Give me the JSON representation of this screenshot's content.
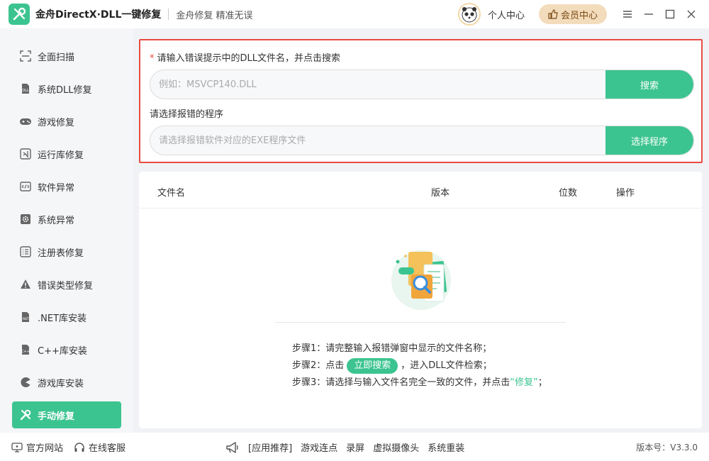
{
  "app": {
    "title": "金舟DirectX·DLL一键修复",
    "slogan": "金舟修复 精准无误",
    "personal_center": "个人中心",
    "vip_center": "会员中心"
  },
  "sidebar": {
    "items": [
      {
        "label": "全面扫描",
        "icon": "scan-icon"
      },
      {
        "label": "系统DLL修复",
        "icon": "dll-icon"
      },
      {
        "label": "游戏修复",
        "icon": "gamepad-icon"
      },
      {
        "label": "运行库修复",
        "icon": "vs-icon"
      },
      {
        "label": "软件异常",
        "icon": "code-icon"
      },
      {
        "label": "系统异常",
        "icon": "gear-icon"
      },
      {
        "label": "注册表修复",
        "icon": "list-icon"
      },
      {
        "label": "错误类型修复",
        "icon": "warning-icon"
      },
      {
        "label": ".NET库安装",
        "icon": "net-icon"
      },
      {
        "label": "C++库安装",
        "icon": "cpp-icon"
      },
      {
        "label": "游戏库安装",
        "icon": "pacman-icon"
      },
      {
        "label": "手动修复",
        "icon": "wrench-icon",
        "active": true
      }
    ]
  },
  "search": {
    "dll_label": "请输入错误提示中的DLL文件名，并点击搜索",
    "dll_required_mark": "*",
    "dll_placeholder": "例如：MSVCP140.DLL",
    "dll_value": "",
    "search_button": "搜索",
    "exe_label": "请选择报错的程序",
    "exe_placeholder": "请选择报错软件对应的EXE程序文件",
    "exe_value": "",
    "select_button": "选择程序"
  },
  "results": {
    "columns": [
      "文件名",
      "版本",
      "位数",
      "操作"
    ],
    "steps": {
      "step1": "步骤1：请完整输入报错弹窗中显示的文件名称；",
      "step2_prefix": "步骤2：点击",
      "step2_pill": "立即搜索",
      "step2_suffix": "，进入DLL文件检索；",
      "step3_prefix": "步骤3：请选择与输入文件名完全一致的文件，并点击",
      "step3_highlight": "“修复”",
      "step3_suffix": "；"
    }
  },
  "footer": {
    "official_site": "官方网站",
    "online_service": "在线客服",
    "recommend": "[应用推荐]",
    "links": [
      "游戏连点",
      "录屏",
      "虚拟摄像头",
      "系统重装"
    ],
    "version": "版本号：V3.3.0"
  },
  "colors": {
    "accent": "#3cc490",
    "highlight_border": "#e94b43",
    "vip_bg": "#f3dcbc"
  }
}
